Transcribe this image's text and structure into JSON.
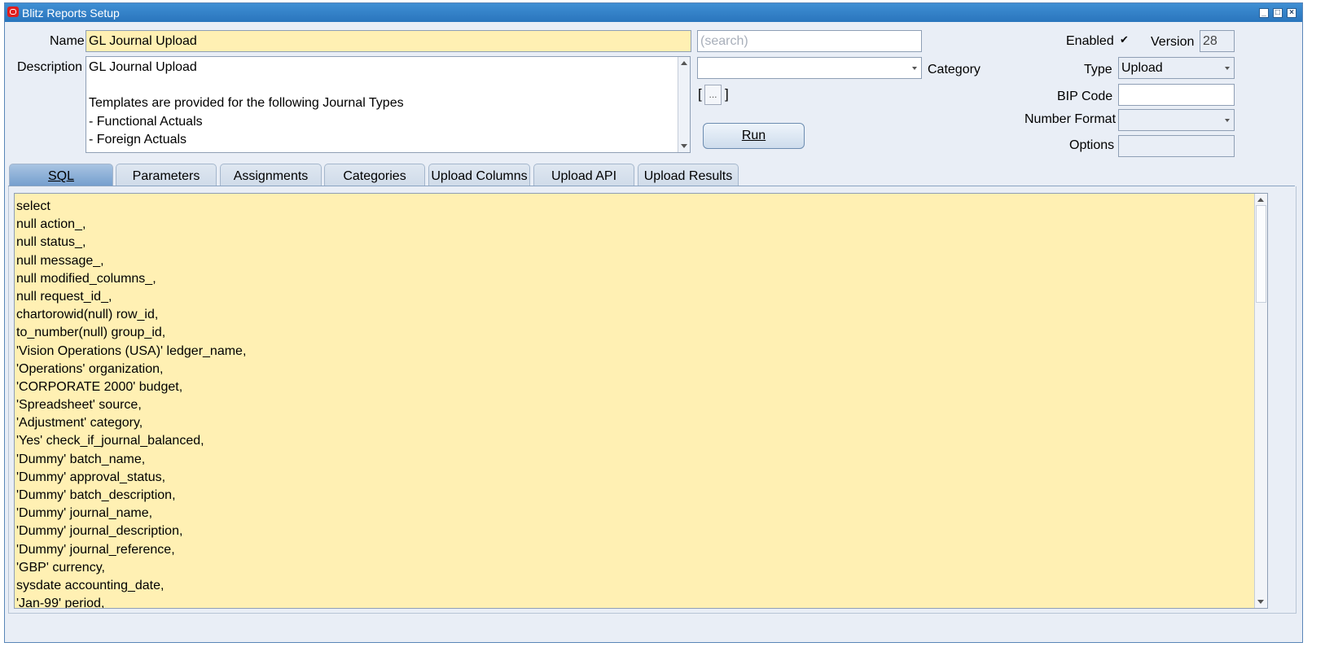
{
  "window": {
    "title": "Blitz Reports Setup"
  },
  "form": {
    "name_label": "Name",
    "name_value": "GL Journal Upload",
    "search_placeholder": "(search)",
    "description_label": "Description",
    "description_value": "GL Journal Upload\n\nTemplates are provided for the following Journal Types\n- Functional Actuals\n- Foreign Actuals",
    "category_label": "Category",
    "category_value": "",
    "ellipsis": "...",
    "run_label": "Run",
    "enabled_label": "Enabled",
    "enabled_checked": true,
    "version_label": "Version",
    "version_value": "28",
    "type_label": "Type",
    "type_value": "Upload",
    "bip_code_label": "BIP Code",
    "bip_code_value": "",
    "number_format_label": "Number Format",
    "number_format_value": "",
    "options_label": "Options",
    "options_value": ""
  },
  "tabs": [
    {
      "label": "SQL",
      "active": true
    },
    {
      "label": "Parameters",
      "active": false
    },
    {
      "label": "Assignments",
      "active": false
    },
    {
      "label": "Categories",
      "active": false
    },
    {
      "label": "Upload Columns",
      "active": false
    },
    {
      "label": "Upload API",
      "active": false
    },
    {
      "label": "Upload Results",
      "active": false
    }
  ],
  "sql_lines": [
    "select",
    "null action_,",
    "null status_,",
    "null message_,",
    "null modified_columns_,",
    "null request_id_,",
    "chartorowid(null) row_id,",
    "to_number(null) group_id,",
    "'Vision Operations (USA)' ledger_name,",
    "'Operations' organization,",
    "'CORPORATE 2000' budget,",
    "'Spreadsheet' source,",
    "'Adjustment' category,",
    "'Yes' check_if_journal_balanced,",
    "'Dummy' batch_name,",
    "'Dummy' approval_status,",
    "'Dummy' batch_description,",
    "'Dummy' journal_name,",
    "'Dummy' journal_description,",
    "'Dummy' journal_reference,",
    "'GBP' currency,",
    "sysdate accounting_date,",
    "'Jan-99' period,"
  ]
}
